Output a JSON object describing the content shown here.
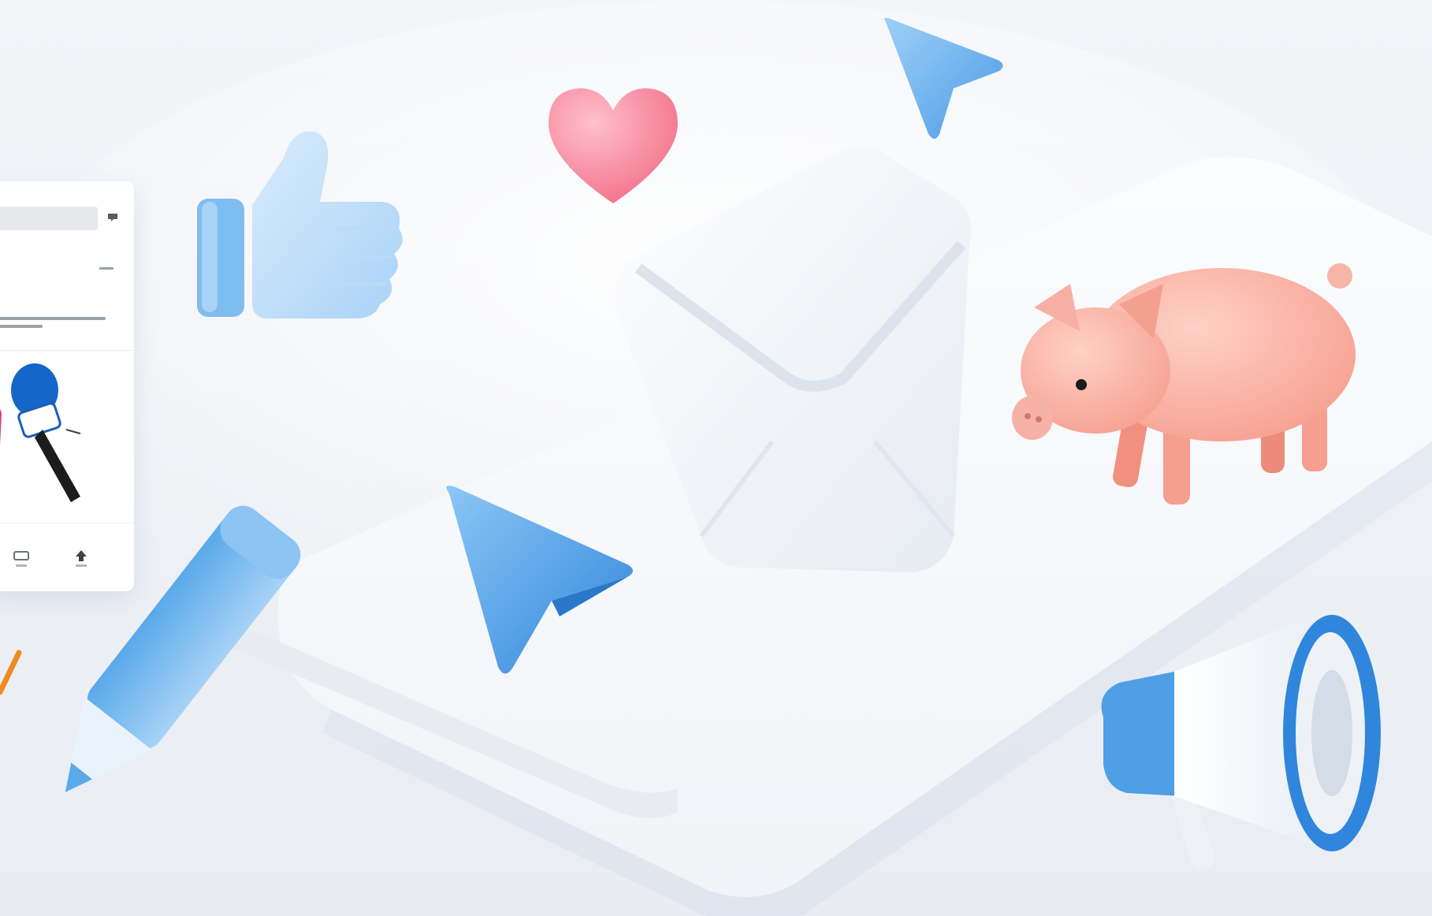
{
  "scene": {
    "icons": [
      "thumbs-up-icon",
      "heart-icon",
      "send-arrow-icon",
      "envelope-icon",
      "piggy-bank-icon",
      "pencil-icon",
      "megaphone-icon",
      "microphone-icon",
      "search-icon"
    ],
    "colors": {
      "background": "#eef1f6",
      "icon_blue": "#5aa9ea",
      "icon_blue_dark": "#2f86dc",
      "heart_pink": "#f26c86",
      "pig_pink": "#f7a79a",
      "accent_orange": "#f08a24",
      "card_white": "#ffffff"
    }
  }
}
